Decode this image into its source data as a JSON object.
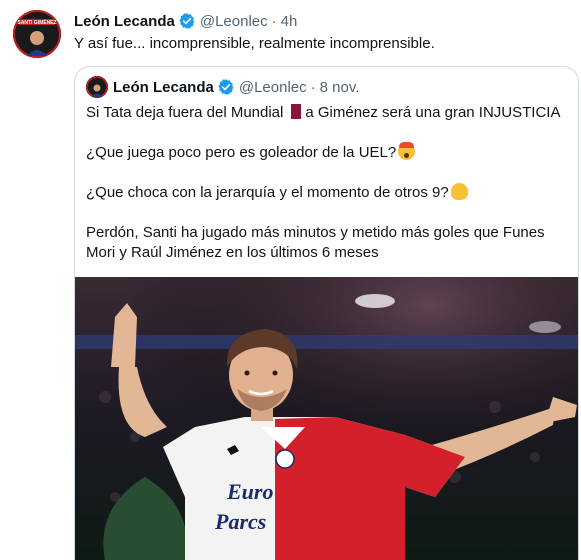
{
  "tweet": {
    "author_name": "León Lecanda",
    "handle": "@Leonlec",
    "separator": "·",
    "time": "4h",
    "text": "Y así fue... incomprensible, realmente incomprensible.",
    "avatar_label": "SANTI GIMÉNEZ"
  },
  "quote": {
    "author_name": "León Lecanda",
    "handle": "@Leonlec",
    "separator": "·",
    "time": "8 nov.",
    "line1_before_flag": "Si Tata deja fuera del Mundial",
    "line1_after_flag": "a Giménez será una gran INJUSTICIA",
    "line2": "¿Que juega poco pero es goleador de la UEL?",
    "line3": "¿Que choca con la jerarquía y el momento de otros 9?",
    "line4": "Perdón, Santi ha jugado más minutos y metido más goles que Funes Mori y Raúl Jiménez en los últimos 6 meses",
    "image": {
      "sponsor_line1": "Euro",
      "sponsor_line2": "Parcs"
    }
  },
  "colors": {
    "text": "#0f1419",
    "secondary": "#536471",
    "verified": "#1d9bf0",
    "border": "#cfd9de"
  },
  "icons": [
    "verified-badge-icon",
    "qatar-flag-icon",
    "exploding-head-emoji-icon",
    "melting-face-emoji-icon"
  ]
}
